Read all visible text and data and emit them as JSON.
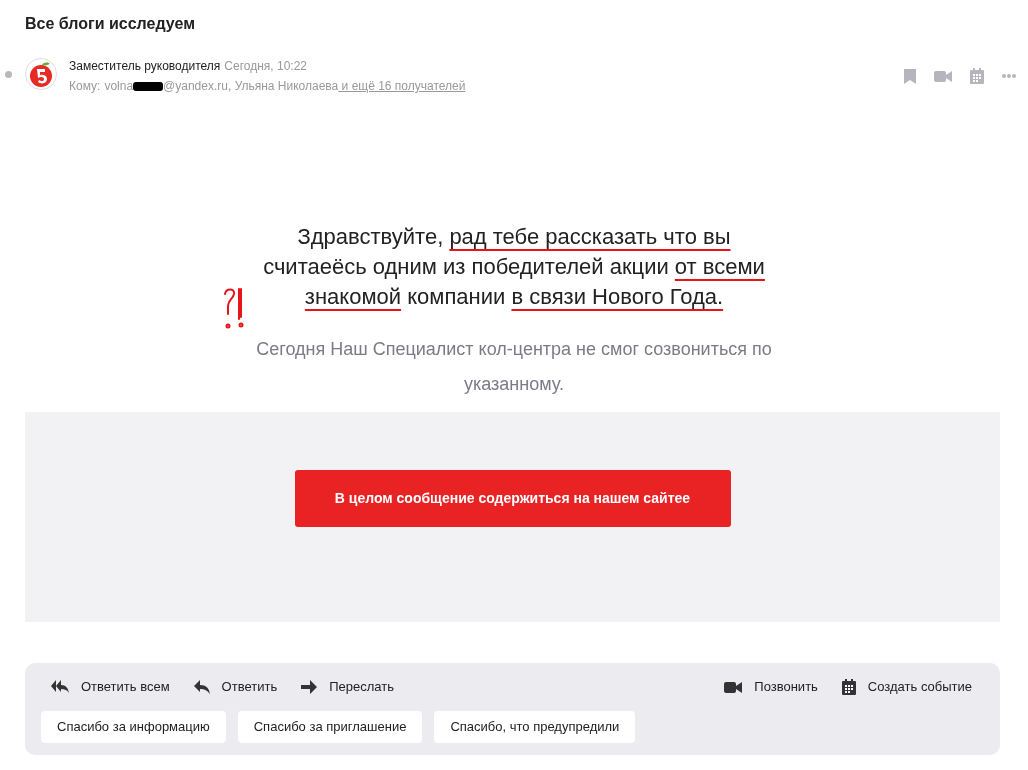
{
  "title": "Все блоги исследуем",
  "message": {
    "unread": true,
    "sender": "Заместитель руководителя",
    "date": "Сегодня, 10:22",
    "to_label": "Кому:",
    "to_before_redaction": "volna",
    "to_after_redaction": "@yandex.ru, Ульяна Николаева",
    "more_recipients": " и ещё 16 получателей"
  },
  "toolbar": [
    {
      "kind": "bookmark"
    },
    {
      "kind": "video"
    },
    {
      "kind": "calendar"
    },
    {
      "kind": "more"
    }
  ],
  "body": {
    "greeting_lines": [
      [
        {
          "text": "Здравствуйте, ",
          "underlined": false
        },
        {
          "text": "рад тебе рассказать что вы",
          "underlined": true
        }
      ],
      [
        {
          "text": "считаеёсь одним из победителей акции ",
          "underlined": false
        },
        {
          "text": "от всеми",
          "underlined": true
        }
      ],
      [
        {
          "text": "знакомой",
          "underlined": true
        },
        {
          "text": " компании ",
          "underlined": false
        },
        {
          "text": "в связи Нового Года.",
          "underlined": true
        }
      ]
    ],
    "subtext": "Сегодня Наш Специалист кол-центра не смог созвониться по указанному.",
    "button": "В целом сообщение содержиться на нашем сайтее"
  },
  "actions": [
    {
      "kind": "reply-all",
      "label": "Ответить всем"
    },
    {
      "kind": "reply",
      "label": "Ответить"
    },
    {
      "kind": "forward",
      "label": "Переслать"
    }
  ],
  "right_actions": [
    {
      "kind": "call",
      "label": "Позвонить"
    },
    {
      "kind": "event",
      "label": "Создать событие"
    }
  ],
  "quick_replies": [
    "Спасибо за информацию",
    "Спасибо за приглашение",
    "Спасибо, что предупредили"
  ]
}
